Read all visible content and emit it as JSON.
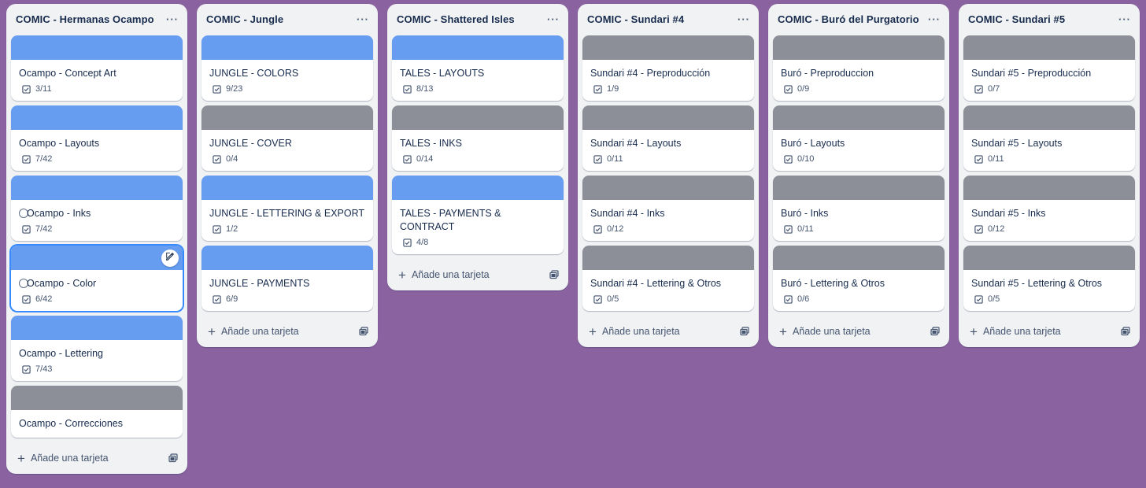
{
  "colors": {
    "blue_cover": "#669df1",
    "gray_cover": "#8c8f97",
    "board_bg": "#8a62a0"
  },
  "add_card_label": "Añade una tarjeta",
  "lists": [
    {
      "title": "COMIC - Hermanas Ocampo",
      "cards": [
        {
          "title": "Ocampo - Concept Art",
          "checklist": "3/11",
          "cover": "blue"
        },
        {
          "title": "Ocampo - Layouts",
          "checklist": "7/42",
          "cover": "blue"
        },
        {
          "title": "Ocampo - Inks",
          "checklist": "7/42",
          "cover": "blue",
          "radio": true
        },
        {
          "title": "Ocampo - Color",
          "checklist": "6/42",
          "cover": "blue",
          "radio": true,
          "selected": true
        },
        {
          "title": "Ocampo - Lettering",
          "checklist": "7/43",
          "cover": "blue"
        },
        {
          "title": "Ocampo - Correcciones",
          "checklist": "",
          "cover": "gray"
        }
      ]
    },
    {
      "title": "COMIC - Jungle",
      "cards": [
        {
          "title": "JUNGLE - COLORS",
          "checklist": "9/23",
          "cover": "blue"
        },
        {
          "title": "JUNGLE - COVER",
          "checklist": "0/4",
          "cover": "gray"
        },
        {
          "title": "JUNGLE - LETTERING & EXPORT",
          "checklist": "1/2",
          "cover": "blue"
        },
        {
          "title": "JUNGLE - PAYMENTS",
          "checklist": "6/9",
          "cover": "blue"
        }
      ]
    },
    {
      "title": "COMIC - Shattered Isles",
      "cards": [
        {
          "title": "TALES - LAYOUTS",
          "checklist": "8/13",
          "cover": "blue"
        },
        {
          "title": "TALES - INKS",
          "checklist": "0/14",
          "cover": "gray"
        },
        {
          "title": "TALES - PAYMENTS & CONTRACT",
          "checklist": "4/8",
          "cover": "blue"
        }
      ]
    },
    {
      "title": "COMIC - Sundari #4",
      "cards": [
        {
          "title": "Sundari #4 - Preproducción",
          "checklist": "1/9",
          "cover": "gray"
        },
        {
          "title": "Sundari #4 - Layouts",
          "checklist": "0/11",
          "cover": "gray"
        },
        {
          "title": "Sundari #4 - Inks",
          "checklist": "0/12",
          "cover": "gray"
        },
        {
          "title": "Sundari #4 - Lettering & Otros",
          "checklist": "0/5",
          "cover": "gray"
        }
      ]
    },
    {
      "title": "COMIC - Buró del Purgatorio",
      "cards": [
        {
          "title": "Buró - Preproduccion",
          "checklist": "0/9",
          "cover": "gray"
        },
        {
          "title": "Buró - Layouts",
          "checklist": "0/10",
          "cover": "gray"
        },
        {
          "title": "Buró - Inks",
          "checklist": "0/11",
          "cover": "gray"
        },
        {
          "title": "Buró - Lettering & Otros",
          "checklist": "0/6",
          "cover": "gray"
        }
      ]
    },
    {
      "title": "COMIC - Sundari #5",
      "cards": [
        {
          "title": "Sundari #5 - Preproducción",
          "checklist": "0/7",
          "cover": "gray"
        },
        {
          "title": "Sundari #5 - Layouts",
          "checklist": "0/11",
          "cover": "gray"
        },
        {
          "title": "Sundari #5 - Inks",
          "checklist": "0/12",
          "cover": "gray"
        },
        {
          "title": "Sundari #5 - Lettering & Otros",
          "checklist": "0/5",
          "cover": "gray"
        }
      ]
    }
  ]
}
